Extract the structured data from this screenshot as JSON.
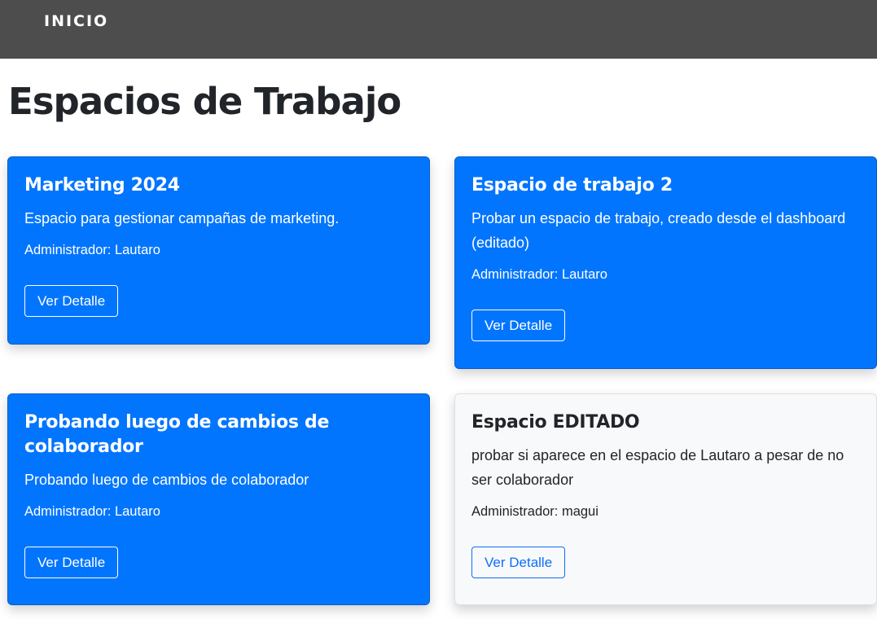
{
  "navbar": {
    "home_label": "INICIO"
  },
  "page": {
    "title": "Espacios de Trabajo"
  },
  "workspaces": [
    {
      "title": "Marketing 2024",
      "description": "Espacio para gestionar campañas de marketing.",
      "admin": "Administrador: Lautaro",
      "button_label": "Ver Detalle",
      "style": "primary"
    },
    {
      "title": "Espacio de trabajo 2",
      "description": "Probar un espacio de trabajo, creado desde el dashboard (editado)",
      "admin": "Administrador: Lautaro",
      "button_label": "Ver Detalle",
      "style": "primary"
    },
    {
      "title": "Probando luego de cambios de colaborador",
      "description": "Probando luego de cambios de colaborador",
      "admin": "Administrador: Lautaro",
      "button_label": "Ver Detalle",
      "style": "primary"
    },
    {
      "title": "Espacio EDITADO",
      "description": "probar si aparece en el espacio de Lautaro a pesar de no ser colaborador",
      "admin": "Administrador: magui",
      "button_label": "Ver Detalle",
      "style": "light"
    }
  ],
  "colors": {
    "navbar_bg": "#4d4d4d",
    "primary_card_bg": "#0275fe",
    "light_card_bg": "#f8f9fa",
    "outline_button_primary": "#0d6efd"
  }
}
